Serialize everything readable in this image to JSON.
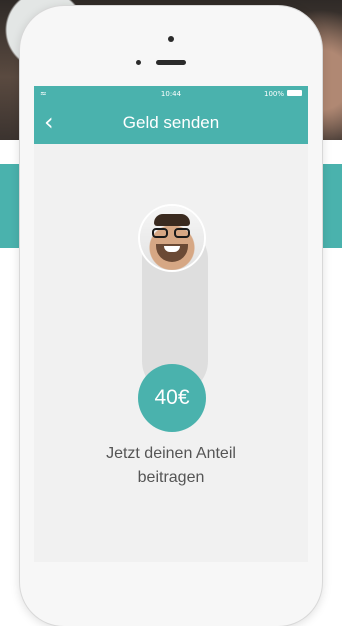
{
  "status_bar": {
    "signal_icon": "wifi-icon",
    "time": "10:44",
    "battery_percent": "100%",
    "battery_icon": "battery-icon"
  },
  "nav": {
    "back_icon": "chevron-left-icon",
    "title": "Geld senden"
  },
  "contribution": {
    "amount": "40€",
    "prompt_line1": "Jetzt deinen Anteil",
    "prompt_line2": "beitragen"
  },
  "colors": {
    "accent": "#4ab2ad",
    "track": "#dedede",
    "text": "#555555"
  }
}
